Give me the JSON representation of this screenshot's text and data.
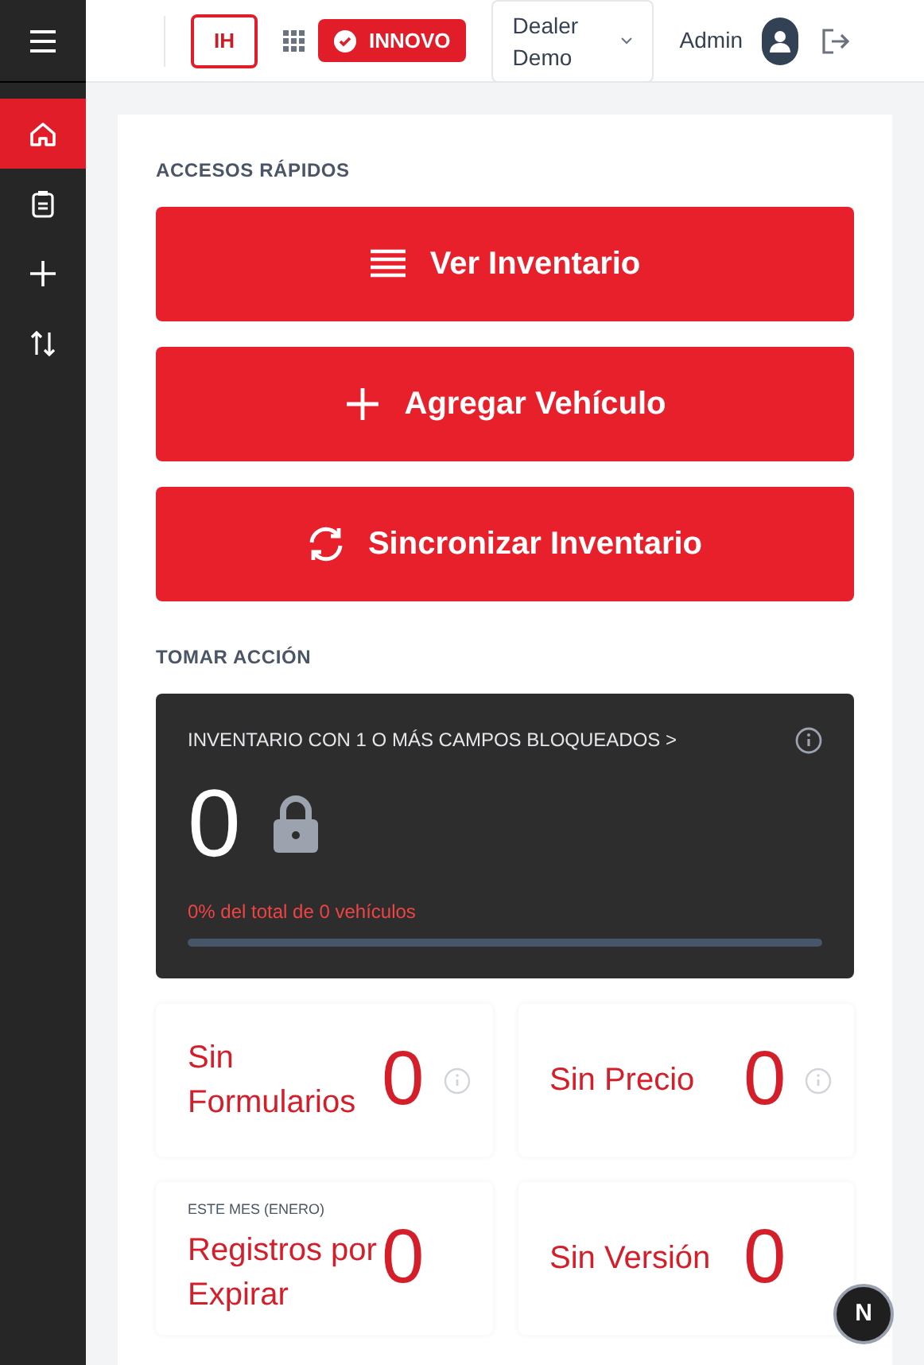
{
  "sidebar": {
    "items": [
      {
        "kind": "home",
        "selected": true
      },
      {
        "kind": "clipboard",
        "selected": false
      },
      {
        "kind": "plus",
        "selected": false
      },
      {
        "kind": "arrows",
        "selected": false
      }
    ]
  },
  "header": {
    "logo": "IH",
    "brand": "INNOVO",
    "dealer": "Dealer Demo",
    "user": "Admin"
  },
  "quick_access": {
    "title": "ACCESOS RÁPIDOS",
    "buttons": [
      {
        "kind": "list",
        "label": "Ver Inventario"
      },
      {
        "kind": "plus",
        "label": "Agregar Vehículo"
      },
      {
        "kind": "sync",
        "label": "Sincronizar Inventario"
      }
    ]
  },
  "take_action": {
    "title": "TOMAR ACCIÓN",
    "locked_card": {
      "title": "INVENTARIO CON 1 O MÁS CAMPOS BLOQUEADOS >",
      "value": "0",
      "caption": "0% del total de 0 vehículos",
      "level": 0
    },
    "cards": [
      {
        "label": "Sin Formularios",
        "value": "0",
        "info": true
      },
      {
        "label": "Sin Precio",
        "value": "0",
        "info": true
      },
      {
        "caption": "ESTE MES (ENERO)",
        "label": "Registros por Expirar",
        "value": "0",
        "info": false
      },
      {
        "label": "Sin Versión",
        "value": "0",
        "info": false
      }
    ]
  },
  "dev_badge": "N"
}
